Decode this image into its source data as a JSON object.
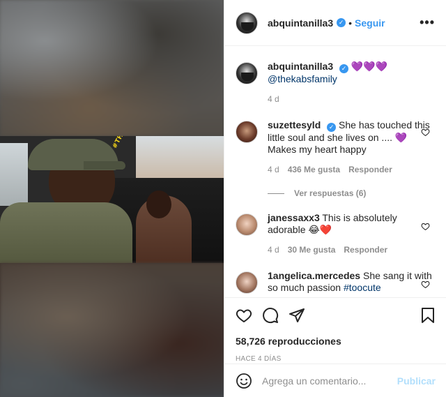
{
  "header": {
    "username": "abquintanilla3",
    "verified_mark": "✓",
    "separator": "•",
    "follow_label": "Seguir",
    "more_label": "•••"
  },
  "video": {
    "watermark": "#THEKABSFAMILY"
  },
  "caption": {
    "username": "abquintanilla3",
    "emojis": "💜💜💜",
    "mention": "@thekabsfamily",
    "time": "4 d"
  },
  "comments": [
    {
      "username": "suzettesyld",
      "text_part1": "She has touched this little soul and she lives on .... ",
      "emoji": "💜",
      "text_part2": " Makes my heart happy",
      "time": "4 d",
      "likes": "436 Me gusta",
      "reply_label": "Responder"
    },
    {
      "username": "janessaxx3",
      "text": "This is absolutely adorable 😂❤️",
      "time": "4 d",
      "likes": "30 Me gusta",
      "reply_label": "Responder"
    },
    {
      "username": "1angelica.mercedes",
      "text": "She sang it with so much passion ",
      "hashtag": "#toocute"
    }
  ],
  "view_replies": "Ver respuestas (6)",
  "stats": {
    "views": "58,726 reproducciones",
    "posted": "HACE 4 DÍAS"
  },
  "add_comment": {
    "placeholder": "Agrega un comentario...",
    "post_label": "Publicar"
  },
  "icons": {
    "like": "heart-icon",
    "comment": "comment-icon",
    "share": "share-icon",
    "save": "bookmark-icon",
    "emoji": "emoji-icon"
  },
  "colors": {
    "link_blue": "#3897f0",
    "publish_disabled": "#b2dffc",
    "muted": "#8e8e8e"
  }
}
